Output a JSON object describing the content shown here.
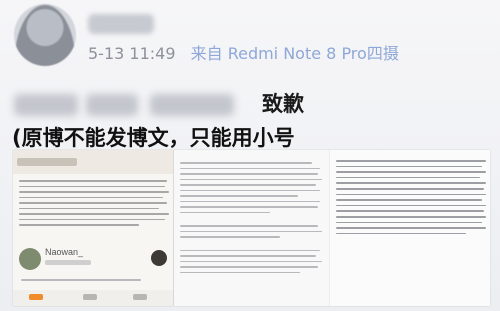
{
  "post": {
    "time": "5-13 11:49",
    "source": "来自 Redmi Note 8 Pro四摄"
  },
  "headline": "致歉",
  "subline": "(原博不能发博文，只能用小号",
  "screenshot_panel": {
    "author": "Naowan_"
  }
}
